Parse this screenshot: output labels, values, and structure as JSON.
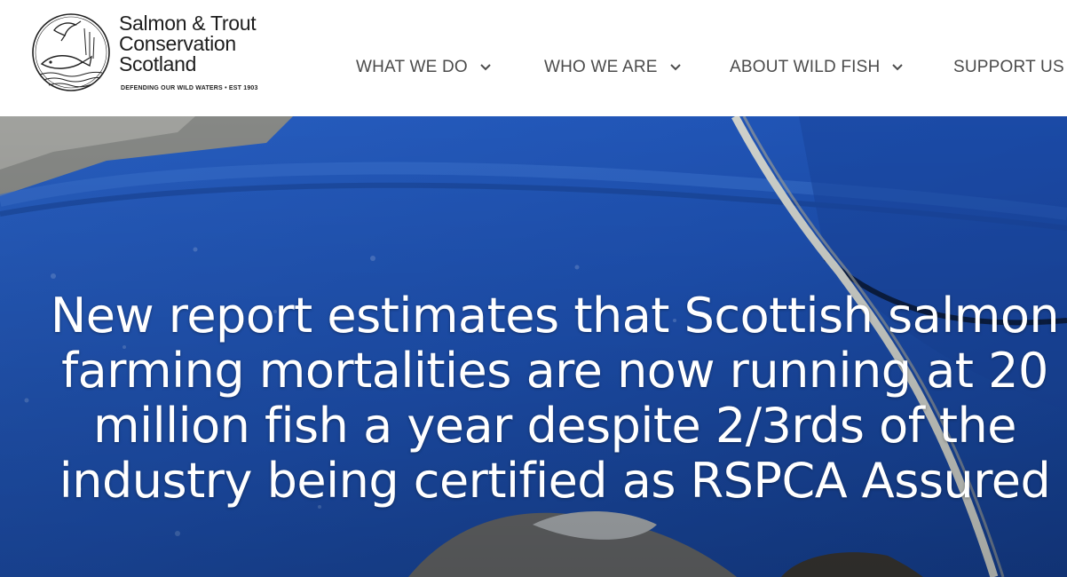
{
  "logo": {
    "brand_lines": [
      "Salmon & Trout",
      "Conservation",
      "Scotland"
    ],
    "tagline": "DEFENDING OUR WILD WATERS • EST 1903",
    "icon": "bird-fish-emblem-icon"
  },
  "nav": {
    "items": [
      {
        "label": "WHAT WE DO",
        "icon": "chevron-down-icon"
      },
      {
        "label": "WHO WE ARE",
        "icon": "chevron-down-icon"
      },
      {
        "label": "ABOUT WILD FISH",
        "icon": "chevron-down-icon"
      },
      {
        "label": "SUPPORT US"
      }
    ]
  },
  "hero": {
    "headline": "New report estimates that Scottish salmon farming mortalities are now running at 20 million fish a year despite 2/3rds of the industry being certified as RSPCA Assured"
  },
  "colors": {
    "nav_text": "#4b4b4b",
    "hero_blue": "#1e54b8",
    "headline_text": "#ffffff"
  }
}
